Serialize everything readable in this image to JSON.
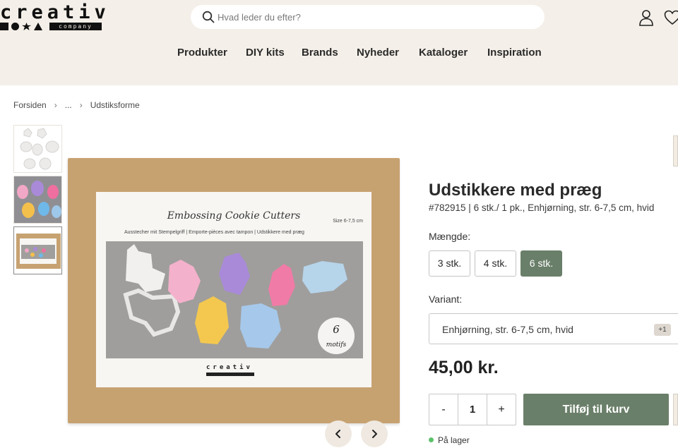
{
  "header": {
    "logo_text": "creativ",
    "logo_company": "company",
    "search_placeholder": "Hvad leder du efter?",
    "background": "#f4efe8"
  },
  "nav": {
    "items": [
      "Produkter",
      "DIY kits",
      "Brands",
      "Nyheder",
      "Kataloger",
      "Inspiration"
    ]
  },
  "breadcrumb": [
    "Forsiden",
    "...",
    "Udstiksforme"
  ],
  "gallery": {
    "box": {
      "title": "Embossing Cookie Cutters",
      "size": "Size 6-7,5 cm",
      "languages": "Ausstecher mit Stempelgriff  |  Emporte-pièces avec tampon  |  Udstikkere med præg",
      "badge_number": "6",
      "badge_word": "motifs",
      "logo": "creativ"
    }
  },
  "product": {
    "title": "Udstikkere med præg",
    "subtitle": "#782915 | 6 stk./ 1 pk., Enhjørning, str. 6-7,5 cm, hvid",
    "quantity_label": "Mængde:",
    "quantity_options": [
      "3 stk.",
      "4 stk.",
      "6 stk."
    ],
    "selected_quantity": "6 stk.",
    "variant_label": "Variant:",
    "variant_value": "Enhjørning, str. 6-7,5 cm, hvid",
    "variant_extra": "+1",
    "price": "45,00 kr.",
    "stepper": {
      "minus": "-",
      "value": "1",
      "plus": "+"
    },
    "add_to_cart": "Tilføj til kurv",
    "stock": "På lager",
    "accent_color": "#6a7f69",
    "stock_color": "#5cc26c"
  }
}
